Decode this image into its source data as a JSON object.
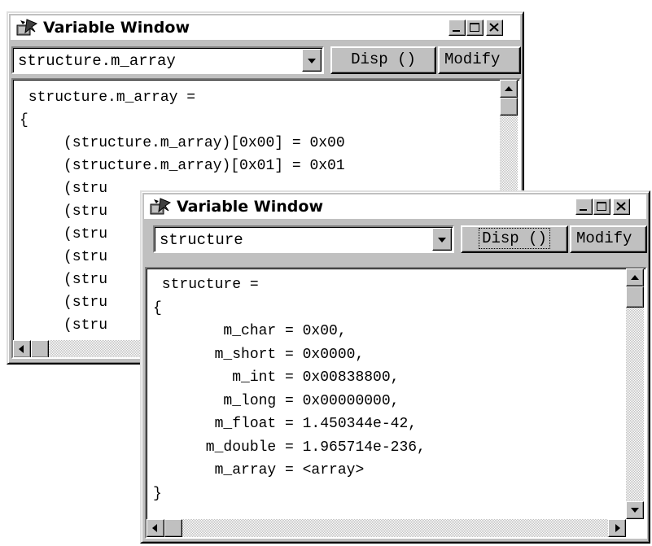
{
  "colors": {
    "face": "#c0c0c0",
    "title_bg": "#ffffff",
    "text": "#000000",
    "shadow": "#808080",
    "highlight": "#ffffff"
  },
  "back_window": {
    "title": "Variable Window",
    "expression_value": "structure.m_array",
    "disp_label": "Disp ()",
    "modify_label": "Modify",
    "output_lines": [
      " structure.m_array =",
      "{",
      "     (structure.m_array)[0x00] = 0x00",
      "     (structure.m_array)[0x01] = 0x01",
      "     (stru",
      "     (stru",
      "     (stru",
      "     (stru",
      "     (stru",
      "     (stru",
      "     (stru"
    ],
    "icons": {
      "app": "variable-window-app-icon",
      "minimize": "minimize-icon",
      "maximize": "maximize-icon",
      "close": "close-icon",
      "dropdown": "chevron-down-icon"
    }
  },
  "front_window": {
    "title": "Variable Window",
    "expression_value": "structure",
    "disp_label": "Disp ()",
    "modify_label": "Modify",
    "output_lines": [
      " structure =",
      "{",
      "        m_char = 0x00,",
      "       m_short = 0x0000,",
      "         m_int = 0x00838800,",
      "        m_long = 0x00000000,",
      "       m_float = 1.450344e-42,",
      "      m_double = 1.965714e-236,",
      "       m_array = <array>",
      "}"
    ],
    "icons": {
      "app": "variable-window-app-icon",
      "minimize": "minimize-icon",
      "maximize": "maximize-icon",
      "close": "close-icon",
      "dropdown": "chevron-down-icon"
    }
  }
}
